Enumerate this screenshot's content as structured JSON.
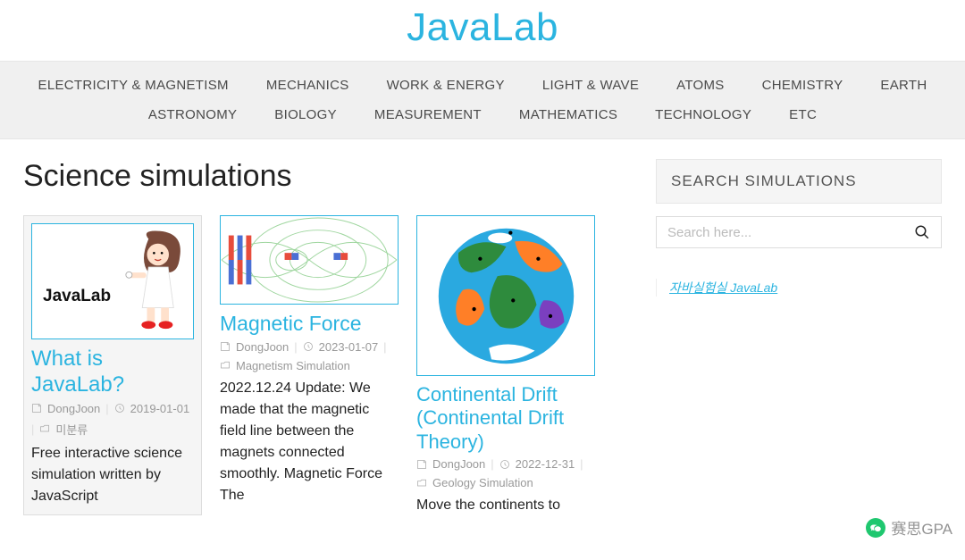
{
  "site": {
    "title": "JavaLab"
  },
  "nav": {
    "row1": [
      "ELECTRICITY & MAGNETISM",
      "MECHANICS",
      "WORK & ENERGY",
      "LIGHT & WAVE",
      "ATOMS",
      "CHEMISTRY",
      "EARTH"
    ],
    "row2": [
      "ASTRONOMY",
      "BIOLOGY",
      "MEASUREMENT",
      "MATHEMATICS",
      "TECHNOLOGY",
      "ETC"
    ]
  },
  "page": {
    "title": "Science simulations"
  },
  "cards": [
    {
      "title": "What is JavaLab?",
      "author": "DongJoon",
      "date": "2019-01-01",
      "category": "미분류",
      "excerpt": "Free interactive science simulation written by JavaScript",
      "thumb": {
        "label": "JavaLab"
      }
    },
    {
      "title": "Magnetic Force",
      "author": "DongJoon",
      "date": "2023-01-07",
      "category": "Magnetism Simulation",
      "excerpt": "2022.12.24 Update: We made that the magnetic field line between the magnets connected smoothly. Magnetic Force The"
    },
    {
      "title": "Continental Drift (Continental Drift Theory)",
      "author": "DongJoon",
      "date": "2022-12-31",
      "category": "Geology Simulation",
      "excerpt": "Move the continents to"
    }
  ],
  "sidebar": {
    "search_title": "SEARCH SIMULATIONS",
    "search_placeholder": "Search here...",
    "link_text": "자바실험실 JavaLab"
  },
  "watermark": {
    "text": "赛思GPA"
  }
}
